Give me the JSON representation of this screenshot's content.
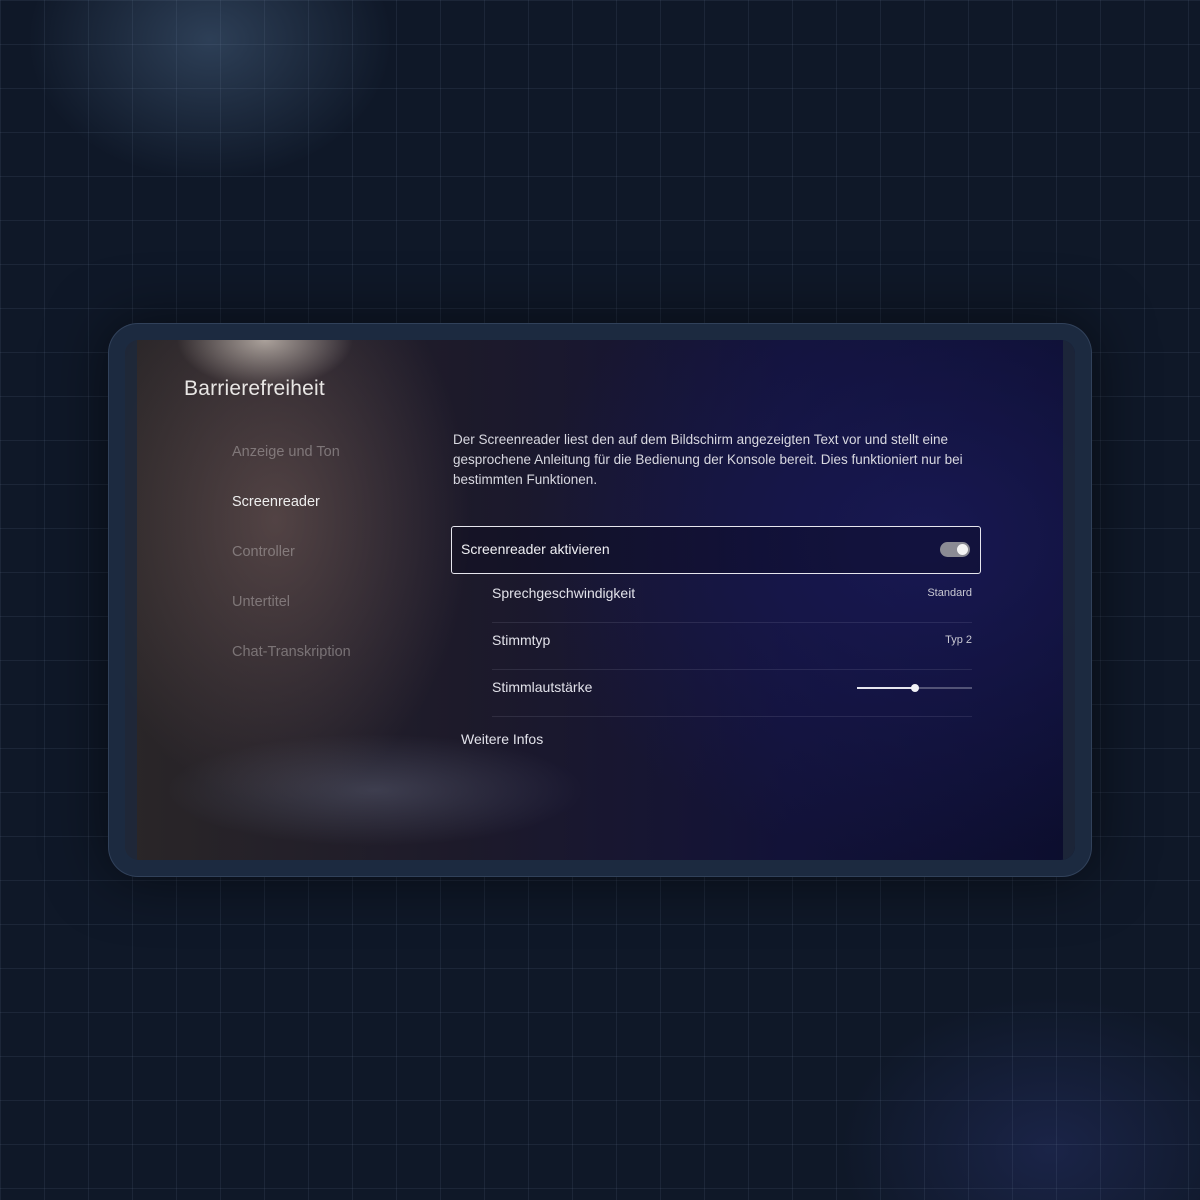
{
  "page": {
    "title": "Barrierefreiheit"
  },
  "sidebar": {
    "items": [
      {
        "label": "Anzeige und Ton",
        "active": false
      },
      {
        "label": "Screenreader",
        "active": true
      },
      {
        "label": "Controller",
        "active": false
      },
      {
        "label": "Untertitel",
        "active": false
      },
      {
        "label": "Chat-Transkription",
        "active": false
      }
    ]
  },
  "main": {
    "description": "Der Screenreader liest den auf dem Bildschirm angezeigten Text vor und stellt eine gesprochene Anleitung für die Bedienung der Konsole bereit. Dies funktioniert nur bei bestimmten Funktionen.",
    "enable_option": {
      "label": "Screenreader aktivieren",
      "enabled": true
    },
    "speech_rate": {
      "label": "Sprechgeschwindigkeit",
      "value": "Standard"
    },
    "voice_type": {
      "label": "Stimmtyp",
      "value": "Typ 2"
    },
    "voice_volume": {
      "label": "Stimmlautstärke",
      "level": 0.5
    },
    "more_info_label": "Weitere Infos"
  }
}
